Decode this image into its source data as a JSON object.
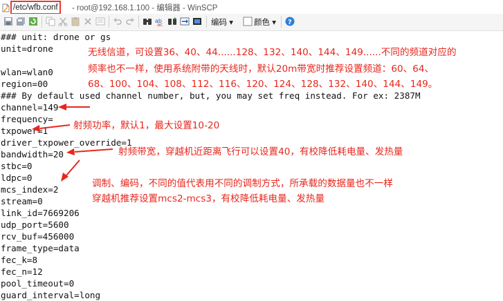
{
  "window": {
    "file_path": "/etc/wfb.conf",
    "title_rest": "- root@192.168.1.100 - 编辑器 - WinSCP"
  },
  "toolbar": {
    "encoding_label": "编码",
    "color_label": "颜色",
    "icons": [
      "save-icon",
      "save-all-icon",
      "reload-icon",
      "copy-icon",
      "cut-icon",
      "paste-icon",
      "delete-icon",
      "select-all-icon",
      "undo-icon",
      "redo-icon",
      "find-icon",
      "replace-icon",
      "find-next-icon",
      "goto-line-icon",
      "encoding-icon",
      "color-icon",
      "help-icon"
    ]
  },
  "editor": {
    "lines": [
      "### unit: drone or gs",
      "unit=drone",
      "",
      "wlan=wlan0",
      "region=00",
      "### By default used channel number, but, you may set freq instead. For ex: 2387M",
      "channel=149",
      "frequency=",
      "txpower=1",
      "driver_txpower_override=1",
      "bandwidth=20",
      "stbc=0",
      "ldpc=0",
      "mcs_index=2",
      "stream=0",
      "link_id=7669206",
      "udp_port=5600",
      "rcv_buf=456000",
      "frame_type=data",
      "fec_k=8",
      "fec_n=12",
      "pool_timeout=0",
      "guard_interval=long"
    ]
  },
  "annotations": {
    "channel_note": [
      "无线信道，可设置36、40、44......128、132、140、144、149......不同的频道对应的",
      "频率也不一样，使用系统附带的天线时，默认20m带宽时推荐设置频道：60、64、",
      "68、100、104、108、112、116、120、124、128、132、140、144、149。"
    ],
    "txpower_note": "射频功率，默认1，最大设置10-20",
    "bandwidth_note": "射频带宽，穿越机近距离飞行可以设置40，有校降低耗电量、发热量",
    "mcs_note": [
      "调制、编码，不同的值代表用不同的调制方式，所承载的数据量也不一样",
      "穿越机推荐设置mcs2-mcs3，有校降低耗电量、发热量"
    ],
    "color": "#e8261c"
  }
}
